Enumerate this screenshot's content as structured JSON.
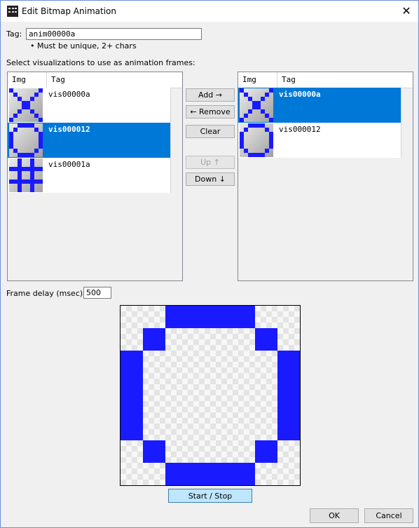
{
  "window": {
    "title": "Edit Bitmap Animation",
    "close_glyph": "✕"
  },
  "tag": {
    "label": "Tag:",
    "value": "anim00000a",
    "hint": "• Must be unique, 2+ chars"
  },
  "select_label": "Select visualizations to use as animation frames:",
  "available": {
    "headers": {
      "img": "Img",
      "tag": "Tag"
    },
    "rows": [
      {
        "tag": "vis00000a",
        "pattern": "x",
        "selected": false
      },
      {
        "tag": "vis000012",
        "pattern": "o",
        "selected": true
      },
      {
        "tag": "vis00001a",
        "pattern": "hash",
        "selected": false
      }
    ]
  },
  "frames": {
    "headers": {
      "img": "Img",
      "tag": "Tag"
    },
    "rows": [
      {
        "tag": "vis00000a",
        "pattern": "x",
        "selected": true
      },
      {
        "tag": "vis000012",
        "pattern": "o",
        "selected": false
      }
    ]
  },
  "buttons": {
    "add": "Add →",
    "remove": "← Remove",
    "clear": "Clear",
    "up": "Up ↑",
    "down": "Down ↓",
    "start_stop": "Start / Stop",
    "ok": "OK",
    "cancel": "Cancel"
  },
  "frame_delay": {
    "label": "Frame delay (msec):",
    "value": "500"
  },
  "preview": {
    "pattern": "o"
  },
  "colors": {
    "pixel": "#1a1aff",
    "selection": "#0078d7",
    "accent_button": "#bee6fd"
  },
  "patterns": {
    "x": [
      "10000001",
      "01000010",
      "00100100",
      "00011000",
      "00011000",
      "00100100",
      "01000010",
      "10000001"
    ],
    "o": [
      "00111100",
      "01000010",
      "10000001",
      "10000001",
      "10000001",
      "10000001",
      "01000010",
      "00111100"
    ],
    "hash": [
      "00100100",
      "00100100",
      "11111111",
      "00100100",
      "00100100",
      "11111111",
      "00100100",
      "00100100"
    ]
  }
}
